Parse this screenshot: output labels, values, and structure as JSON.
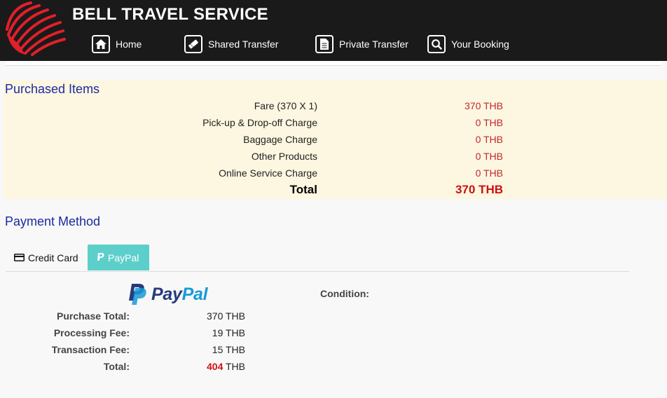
{
  "header": {
    "brand": "BELL TRAVEL SERVICE",
    "nav": [
      {
        "label": "Home",
        "icon": "home-icon"
      },
      {
        "label": "Shared Transfer",
        "icon": "ticket-icon"
      },
      {
        "label": "Private Transfer",
        "icon": "document-icon"
      },
      {
        "label": "Your Booking",
        "icon": "search-icon"
      }
    ]
  },
  "purchased": {
    "title": "Purchased Items",
    "items": [
      {
        "label": "Fare (370 X 1)",
        "value": "370 THB"
      },
      {
        "label": "Pick-up & Drop-off Charge",
        "value": "0 THB"
      },
      {
        "label": "Baggage Charge",
        "value": "0 THB"
      },
      {
        "label": "Other Products",
        "value": "0 THB"
      },
      {
        "label": "Online Service Charge",
        "value": "0 THB"
      }
    ],
    "total_label": "Total",
    "total_value": "370 THB"
  },
  "payment": {
    "title": "Payment Method",
    "tabs": [
      {
        "label": "Credit Card",
        "icon": "credit-card-icon",
        "active": false
      },
      {
        "label": "PayPal",
        "icon": "paypal-icon",
        "active": true
      }
    ],
    "paypal": {
      "logo_pay": "Pay",
      "logo_pal": "Pal",
      "rows": [
        {
          "label": "Purchase Total:",
          "value": "370 THB"
        },
        {
          "label": "Processing Fee:",
          "value": "19 THB"
        },
        {
          "label": "Transaction Fee:",
          "value": "15 THB"
        }
      ],
      "total_label": "Total:",
      "total_amount": "404",
      "total_currency": "THB"
    },
    "condition_label": "Condition:"
  },
  "colors": {
    "header_bg": "#1a1a1a",
    "title_blue": "#1b2aa0",
    "price_red": "#c0282d",
    "purchased_bg": "#fdf6e1",
    "paypal_tab": "#5dcfcb"
  }
}
